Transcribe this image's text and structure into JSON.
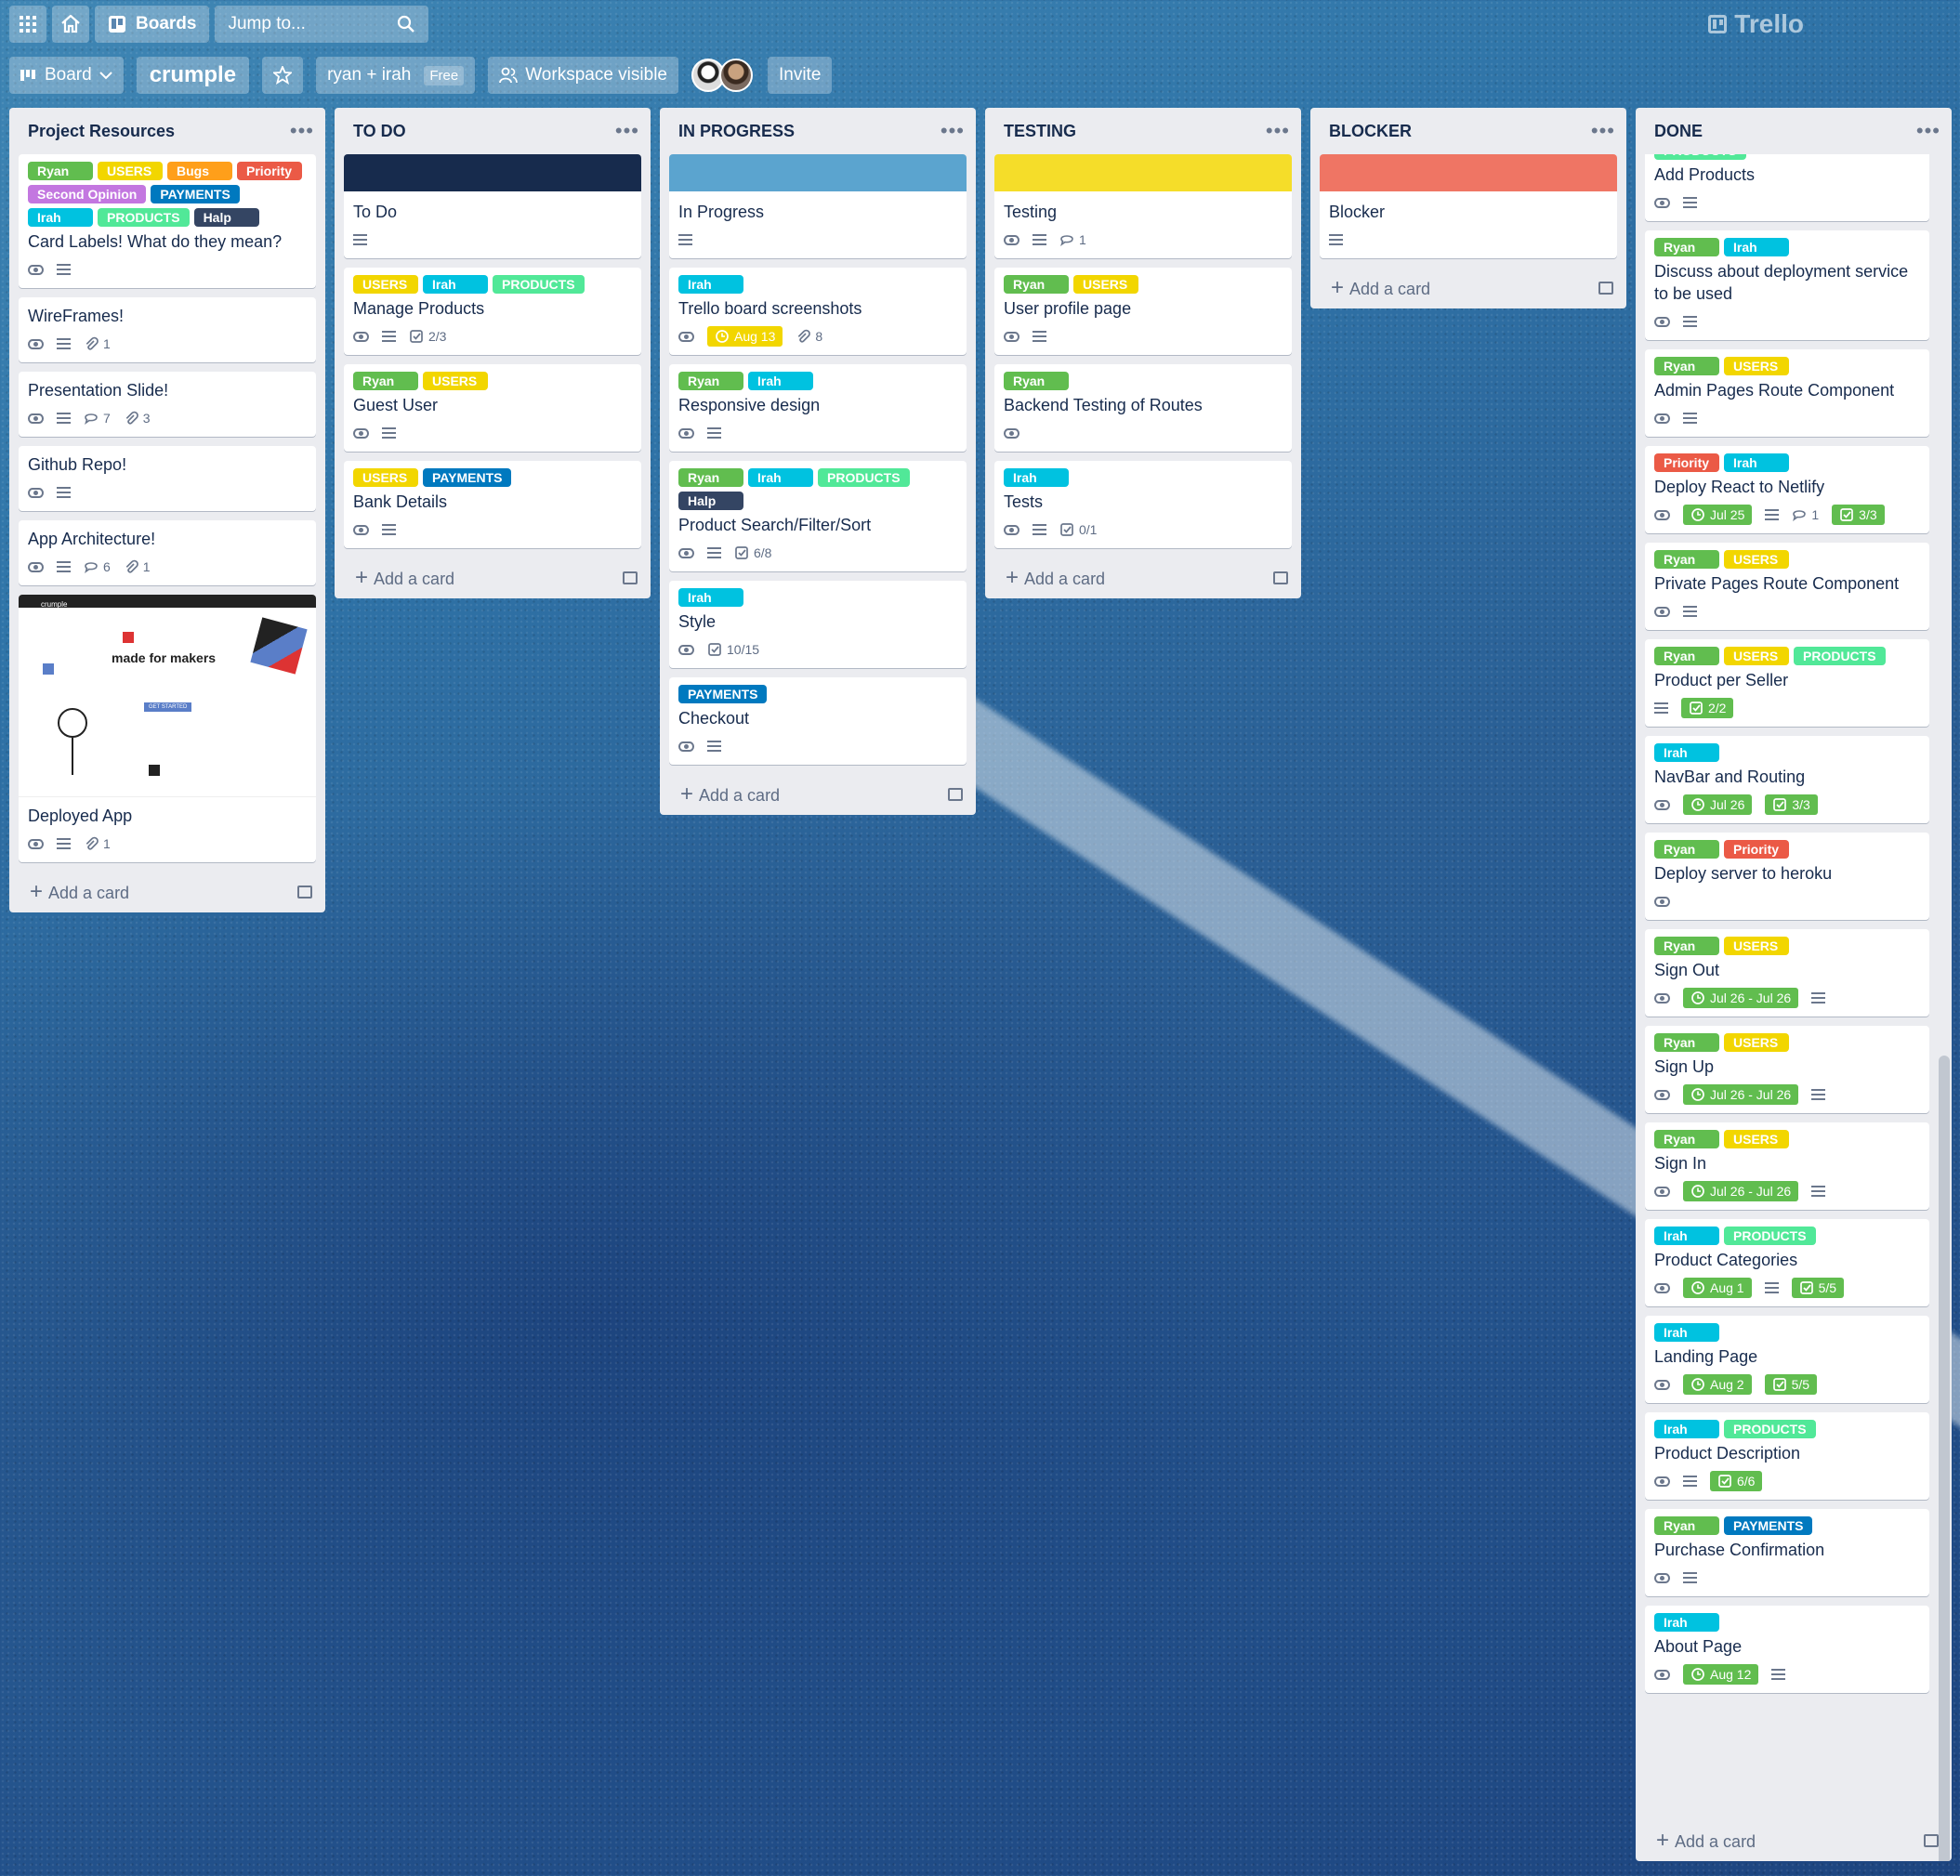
{
  "topnav": {
    "boards_label": "Boards",
    "search_placeholder": "Jump to...",
    "logo_text": "Trello"
  },
  "board": {
    "view_label": "Board",
    "name": "crumple",
    "workspace_name": "ryan + irah",
    "plan_badge": "Free",
    "visibility_label": "Workspace visible",
    "invite_label": "Invite"
  },
  "add_card_label": "Add a card",
  "colors": {
    "Ryan": "#61bd4f",
    "USERS": "#f2d600",
    "Bugs": "#ff9f1a",
    "Priority": "#eb5a46",
    "Second Opinion": "#c377e0",
    "PAYMENTS": "#0079bf",
    "Irah": "#00c2e0",
    "PRODUCTS": "#51e898",
    "Halp": "#344563",
    "due_yellow": "#f2d600",
    "due_green": "#61bd4f",
    "check_green": "#61bd4f"
  },
  "lists": [
    {
      "title": "Project Resources",
      "cards": [
        {
          "labels": [
            "Ryan",
            "USERS",
            "Bugs",
            "Priority",
            "Second Opinion",
            "PAYMENTS",
            "Irah",
            "PRODUCTS",
            "Halp"
          ],
          "title": "Card Labels! What do they mean?",
          "watch": true,
          "desc": true
        },
        {
          "title": "WireFrames!",
          "watch": true,
          "desc": true,
          "attachments": "1"
        },
        {
          "title": "Presentation Slide!",
          "watch": true,
          "desc": true,
          "comments": "7",
          "attachments": "3"
        },
        {
          "title": "Github Repo!",
          "watch": true,
          "desc": true
        },
        {
          "title": "App Architecture!",
          "watch": true,
          "desc": true,
          "comments": "6",
          "attachments": "1"
        },
        {
          "title": "Deployed App",
          "thumb": {
            "brand": "crumple",
            "headline": "made for makers",
            "cta": "GET STARTED"
          },
          "watch": true,
          "desc": true,
          "attachments": "1"
        }
      ]
    },
    {
      "title": "TO DO",
      "cards": [
        {
          "cover": "#172b4d",
          "title": "To Do",
          "desc": true
        },
        {
          "labels": [
            "USERS",
            "Irah",
            "PRODUCTS"
          ],
          "title": "Manage Products",
          "watch": true,
          "desc": true,
          "checklist": "2/3"
        },
        {
          "labels": [
            "Ryan",
            "USERS"
          ],
          "title": "Guest User",
          "watch": true,
          "desc": true
        },
        {
          "labels": [
            "USERS",
            "PAYMENTS"
          ],
          "title": "Bank Details",
          "watch": true,
          "desc": true
        }
      ]
    },
    {
      "title": "IN PROGRESS",
      "cards": [
        {
          "cover": "#5ba4cf",
          "title": "In Progress",
          "desc": true
        },
        {
          "labels": [
            "Irah"
          ],
          "title": "Trello board screenshots",
          "watch": true,
          "due": {
            "text": "Aug 13",
            "style": "yellow"
          },
          "attachments": "8"
        },
        {
          "labels": [
            "Ryan",
            "Irah"
          ],
          "title": "Responsive design",
          "watch": true,
          "desc": true
        },
        {
          "labels": [
            "Ryan",
            "Irah",
            "PRODUCTS",
            "Halp"
          ],
          "title": "Product Search/Filter/Sort",
          "watch": true,
          "desc": true,
          "checklist": "6/8"
        },
        {
          "labels": [
            "Irah"
          ],
          "title": "Style",
          "watch": true,
          "checklist": "10/15"
        },
        {
          "labels": [
            "PAYMENTS"
          ],
          "title": "Checkout",
          "watch": true,
          "desc": true
        }
      ]
    },
    {
      "title": "TESTING",
      "cards": [
        {
          "cover": "#f5dd29",
          "title": "Testing",
          "watch": true,
          "desc": true,
          "comments": "1"
        },
        {
          "labels": [
            "Ryan",
            "USERS"
          ],
          "title": "User profile page",
          "watch": true,
          "desc": true
        },
        {
          "labels": [
            "Ryan"
          ],
          "title": "Backend Testing of Routes",
          "watch": true
        },
        {
          "labels": [
            "Irah"
          ],
          "title": "Tests",
          "watch": true,
          "desc": true,
          "checklist": "0/1"
        }
      ]
    },
    {
      "title": "BLOCKER",
      "cards": [
        {
          "cover": "#ef7564",
          "title": "Blocker",
          "desc": true
        }
      ]
    },
    {
      "title": "DONE",
      "cards": [
        {
          "labels": [
            "PRODUCTS"
          ],
          "title": "Add Products",
          "watch": true,
          "desc": true
        },
        {
          "labels": [
            "Ryan",
            "Irah"
          ],
          "title": "Discuss about deployment service to be used",
          "watch": true,
          "desc": true
        },
        {
          "labels": [
            "Ryan",
            "USERS"
          ],
          "title": "Admin Pages Route Component",
          "watch": true,
          "desc": true
        },
        {
          "labels": [
            "Priority",
            "Irah"
          ],
          "title": "Deploy React to Netlify",
          "watch": true,
          "due": {
            "text": "Jul 25",
            "style": "green"
          },
          "desc": true,
          "comments": "1",
          "checklist_box": "3/3"
        },
        {
          "labels": [
            "Ryan",
            "USERS"
          ],
          "title": "Private Pages Route Component",
          "watch": true,
          "desc": true
        },
        {
          "labels": [
            "Ryan",
            "USERS",
            "PRODUCTS"
          ],
          "title": "Product per Seller",
          "desc": true,
          "checklist_box": "2/2"
        },
        {
          "labels": [
            "Irah"
          ],
          "title": "NavBar and Routing",
          "watch": true,
          "due": {
            "text": "Jul 26",
            "style": "green"
          },
          "checklist_box": "3/3"
        },
        {
          "labels": [
            "Ryan",
            "Priority"
          ],
          "title": "Deploy server to heroku",
          "watch": true
        },
        {
          "labels": [
            "Ryan",
            "USERS"
          ],
          "title": "Sign Out",
          "watch": true,
          "due": {
            "text": "Jul 26 - Jul 26",
            "style": "green"
          },
          "desc": true
        },
        {
          "labels": [
            "Ryan",
            "USERS"
          ],
          "title": "Sign Up",
          "watch": true,
          "due": {
            "text": "Jul 26 - Jul 26",
            "style": "green"
          },
          "desc": true
        },
        {
          "labels": [
            "Ryan",
            "USERS"
          ],
          "title": "Sign In",
          "watch": true,
          "due": {
            "text": "Jul 26 - Jul 26",
            "style": "green"
          },
          "desc": true
        },
        {
          "labels": [
            "Irah",
            "PRODUCTS"
          ],
          "title": "Product Categories",
          "watch": true,
          "due": {
            "text": "Aug 1",
            "style": "green"
          },
          "desc": true,
          "checklist_box": "5/5"
        },
        {
          "labels": [
            "Irah"
          ],
          "title": "Landing Page",
          "watch": true,
          "due": {
            "text": "Aug 2",
            "style": "green"
          },
          "checklist_box": "5/5"
        },
        {
          "labels": [
            "Irah",
            "PRODUCTS"
          ],
          "title": "Product Description",
          "watch": true,
          "desc": true,
          "checklist_box": "6/6"
        },
        {
          "labels": [
            "Ryan",
            "PAYMENTS"
          ],
          "title": "Purchase Confirmation",
          "watch": true,
          "desc": true
        },
        {
          "labels": [
            "Irah"
          ],
          "title": "About Page",
          "watch": true,
          "due": {
            "text": "Aug 12",
            "style": "green"
          },
          "desc": true
        }
      ]
    }
  ]
}
